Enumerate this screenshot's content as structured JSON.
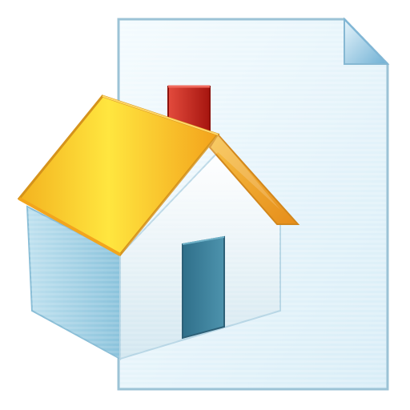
{
  "icon": {
    "name": "home-page-document-icon",
    "parts": [
      "document-page-icon",
      "house-icon"
    ],
    "colors": {
      "page_light": "#f4fbfe",
      "page_mid": "#dceff8",
      "page_edge": "#9cc3d6",
      "page_fold": "#7fb6d6",
      "roof_yellow": "#ffe23a",
      "roof_orange": "#f3a21b",
      "wall_front_light": "#fbfdfe",
      "wall_front_shadow": "#d6e9f2",
      "wall_side": "#aad3e6",
      "door": "#3f7f99",
      "chimney": "#c8281f"
    }
  }
}
